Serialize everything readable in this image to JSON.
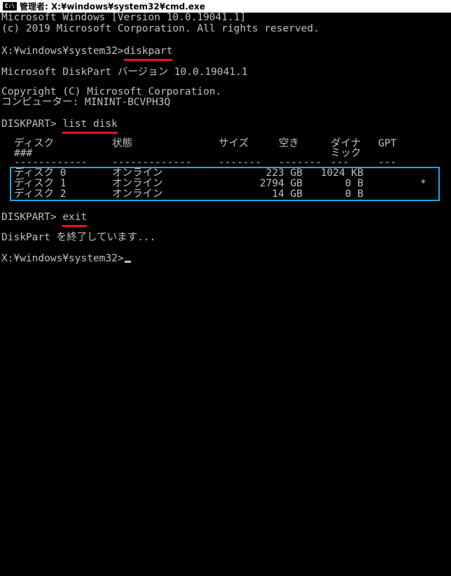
{
  "window": {
    "title": "管理者: X:¥windows¥system32¥cmd.exe",
    "icon_label": "C:\\"
  },
  "console": {
    "header_line1": "Microsoft Windows [Version 10.0.19041.1]",
    "header_line2": "(c) 2019 Microsoft Corporation. All rights reserved.",
    "prompt1": "X:¥windows¥system32>",
    "command1": "diskpart",
    "diskpart_version": "Microsoft DiskPart バージョン 10.0.19041.1",
    "copyright": "Copyright (C) Microsoft Corporation.",
    "computer": "コンピューター: MININT-BCVPH3Q",
    "prompt2": "DISKPART> ",
    "command2": "list disk",
    "table": {
      "headers": {
        "disk": "ディスク",
        "disk_sub": "###",
        "status": "状態",
        "size": "サイズ",
        "free": "空き",
        "dyn": "ダイナ",
        "dyn_sub": "ミック",
        "gpt": "GPT"
      },
      "separators": {
        "disk": "------------",
        "status": "-------------",
        "size": "-------",
        "free": "-------",
        "dyn": "---",
        "gpt": "---"
      },
      "rows": [
        {
          "disk": "ディスク 0",
          "status": "オンライン",
          "size": "223 GB",
          "free": "1024 KB",
          "dyn": "",
          "gpt": ""
        },
        {
          "disk": "ディスク 1",
          "status": "オンライン",
          "size": "2794 GB",
          "free": "0 B",
          "dyn": "",
          "gpt": "*"
        },
        {
          "disk": "ディスク 2",
          "status": "オンライン",
          "size": "14 GB",
          "free": "0 B",
          "dyn": "",
          "gpt": ""
        }
      ]
    },
    "prompt3": "DISKPART> ",
    "command3": "exit",
    "exit_message": "DiskPart を終了しています...",
    "prompt4": "X:¥windows¥system32>"
  },
  "colors": {
    "background": "#000000",
    "text": "#c0c0c0",
    "underline": "#e8102b",
    "highlight_box": "#21a8e0"
  }
}
